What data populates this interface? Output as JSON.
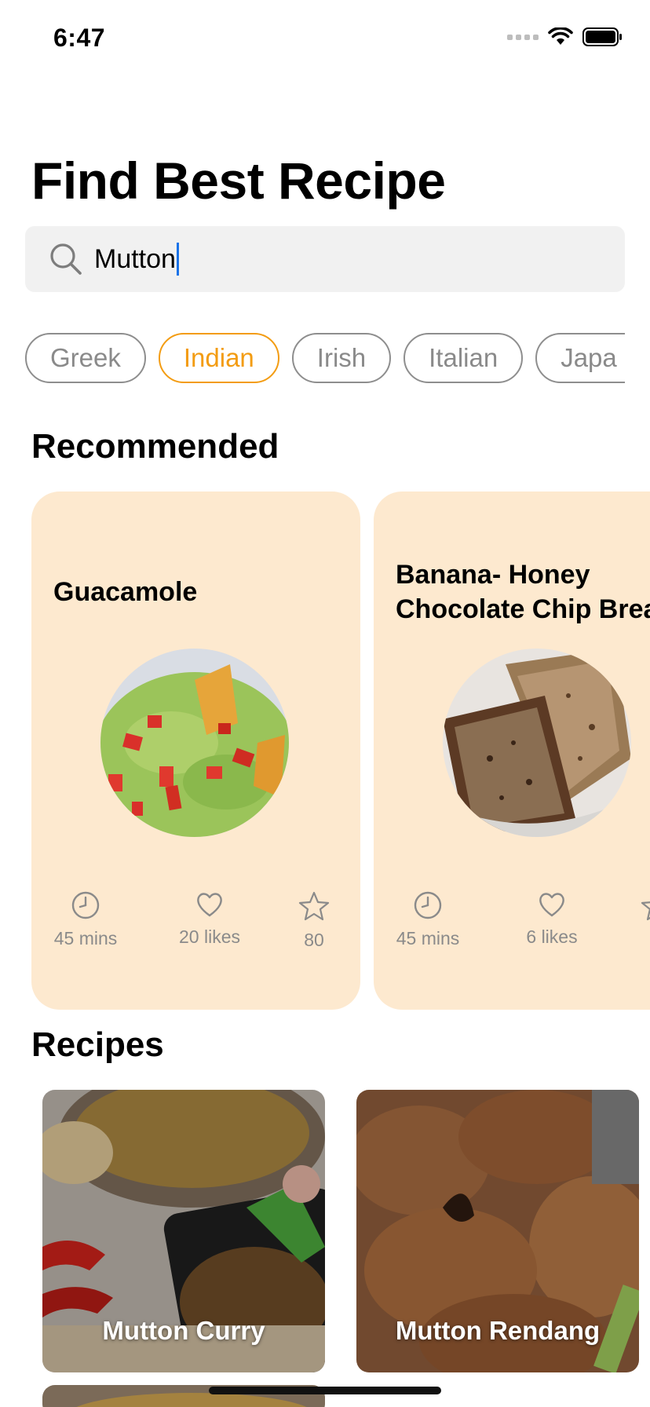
{
  "status_bar": {
    "time": "6:47"
  },
  "header": {
    "title": "Find Best Recipe"
  },
  "search": {
    "value": "Mutton",
    "icon": "search-icon"
  },
  "categories": {
    "selected": "Indian",
    "items": [
      "Greek",
      "Indian",
      "Irish",
      "Italian",
      "Japa"
    ]
  },
  "recommended": {
    "title": "Recommended",
    "cards": [
      {
        "name": "Guacamole",
        "time": "45 mins",
        "likes": "20 likes",
        "rating": "80"
      },
      {
        "name": "Banana- Honey\nChocolate Chip Brea",
        "time": "45 mins",
        "likes": "6 likes",
        "rating": ""
      }
    ]
  },
  "recipes": {
    "title": "Recipes",
    "items": [
      {
        "name": "Mutton Curry"
      },
      {
        "name": "Mutton Rendang"
      }
    ]
  },
  "colors": {
    "accent": "#f39c12",
    "card_bg": "#fde9cf",
    "search_bg": "#f1f1f1",
    "muted_text": "#8a8a8a"
  }
}
